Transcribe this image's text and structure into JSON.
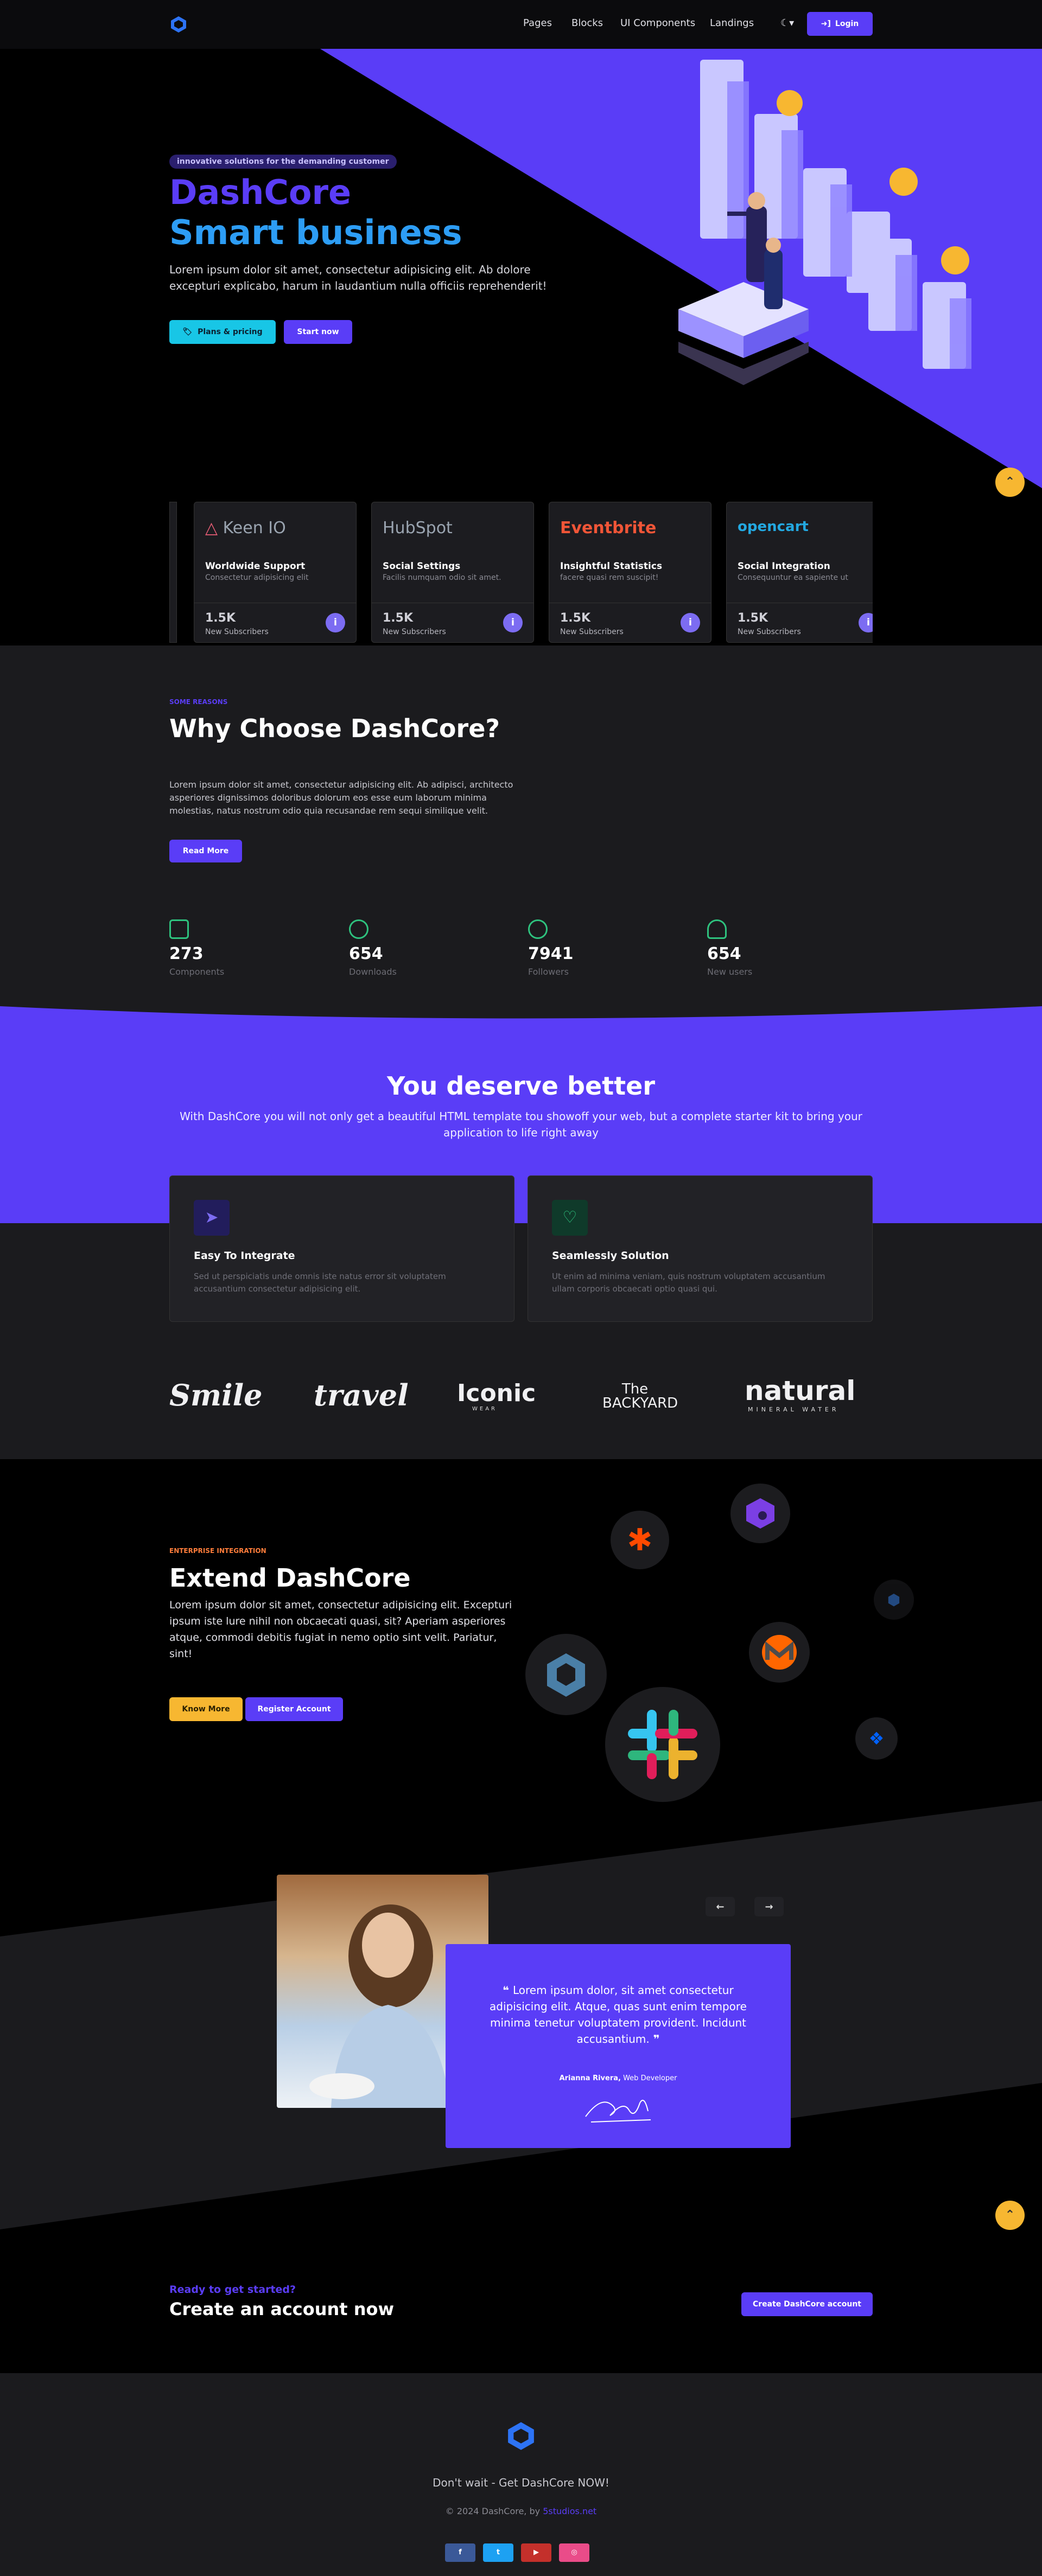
{
  "nav": {
    "links": [
      "Pages",
      "Blocks",
      "UI Components",
      "Landings"
    ],
    "theme_toggle": "☾▾",
    "login": "Login"
  },
  "hero": {
    "badge": "innovative solutions for the demanding customer",
    "title_line1": "DashCore",
    "title_line2": "Smart business",
    "text": "Lorem ipsum dolor sit amet, consectetur adipisicing elit. Ab dolore excepturi explicabo, harum in laudantium nulla officiis reprehenderit!",
    "btn_plans": "Plans & pricing",
    "btn_start": "Start now",
    "cards": [
      {
        "logo": "Keen IO",
        "title": "Worldwide Support",
        "sub": "Consectetur adipisicing elit",
        "num": "1.5K",
        "label": "New Subscribers"
      },
      {
        "logo": "HubSpot",
        "title": "Social Settings",
        "sub": "Facilis numquam odio sit amet.",
        "num": "1.5K",
        "label": "New Subscribers"
      },
      {
        "logo": "Eventbrite",
        "title": "Insightful Statistics",
        "sub": "facere quasi rem suscipit!",
        "num": "1.5K",
        "label": "New Subscribers"
      },
      {
        "logo": "opencart",
        "title": "Social Integration",
        "sub": "Consequuntur ea sapiente ut",
        "num": "1.5K",
        "label": "New Subscribers"
      }
    ],
    "info_icon": "i"
  },
  "why": {
    "eyebrow": "SOME REASONS",
    "title": "Why Choose DashCore?",
    "text": "Lorem ipsum dolor sit amet, consectetur adipisicing elit. Ab adipisci, architecto asperiores dignissimos doloribus dolorum eos esse eum laborum minima molestias, natus nostrum odio quia recusandae rem sequi similique velit.",
    "btn": "Read More",
    "stats": [
      {
        "value": "273",
        "label": "Components"
      },
      {
        "value": "654",
        "label": "Downloads"
      },
      {
        "value": "7941",
        "label": "Followers"
      },
      {
        "value": "654",
        "label": "New users"
      }
    ]
  },
  "deserve": {
    "title": "You deserve better",
    "text": "With DashCore you will not only get a beautiful HTML template tou showoff your web, but a complete starter kit to bring your application to life right away",
    "features": [
      {
        "title": "Easy To Integrate",
        "text": "Sed ut perspiciatis unde omnis iste natus error sit voluptatem accusantium consectetur adipisicing elit."
      },
      {
        "title": "Seamlessly Solution",
        "text": "Ut enim ad minima veniam, quis nostrum voluptatem accusantium ullam corporis obcaecati optio quasi qui."
      }
    ]
  },
  "brands": [
    "Smile",
    "travel",
    "Iconic",
    "The BACKYARD",
    "natural"
  ],
  "brand_subs": {
    "iconic": "WEAR",
    "natural": "MINERAL WATER"
  },
  "extend": {
    "eyebrow": "ENTERPRISE INTEGRATION",
    "title": "Extend DashCore",
    "text": "Lorem ipsum dolor sit amet, consectetur adipisicing elit. Excepturi ipsum iste lure nihil non obcaecati quasi, sit? Aperiam asperiores atque, commodi debitis fugiat in nemo optio sint velit. Pariatur, sint!",
    "btn_know": "Know More",
    "btn_register": "Register Account"
  },
  "testimonial": {
    "quote": "Lorem ipsum dolor, sit amet consectetur adipisicing elit. Atque, quas sunt enim tempore minima tenetur voluptatem provident. Incidunt accusantium.",
    "name": "Arianna Rivera,",
    "role": "Web Developer",
    "prev": "←",
    "next": "→"
  },
  "cta": {
    "eyebrow": "Ready to get started?",
    "title": "Create an account now",
    "btn": "Create DashCore account"
  },
  "footer": {
    "tagline": "Don't wait - Get DashCore NOW!",
    "copyright": "© 2024 DashCore, by",
    "author": "5studios.net",
    "social": [
      "f",
      "t",
      "▶",
      "◎"
    ]
  },
  "scroll_top": "⌃",
  "colors": {
    "primary": "#5a3df7",
    "cyan": "#18c6e6",
    "yellow": "#f7b731",
    "dark": "#1b1b1e"
  }
}
